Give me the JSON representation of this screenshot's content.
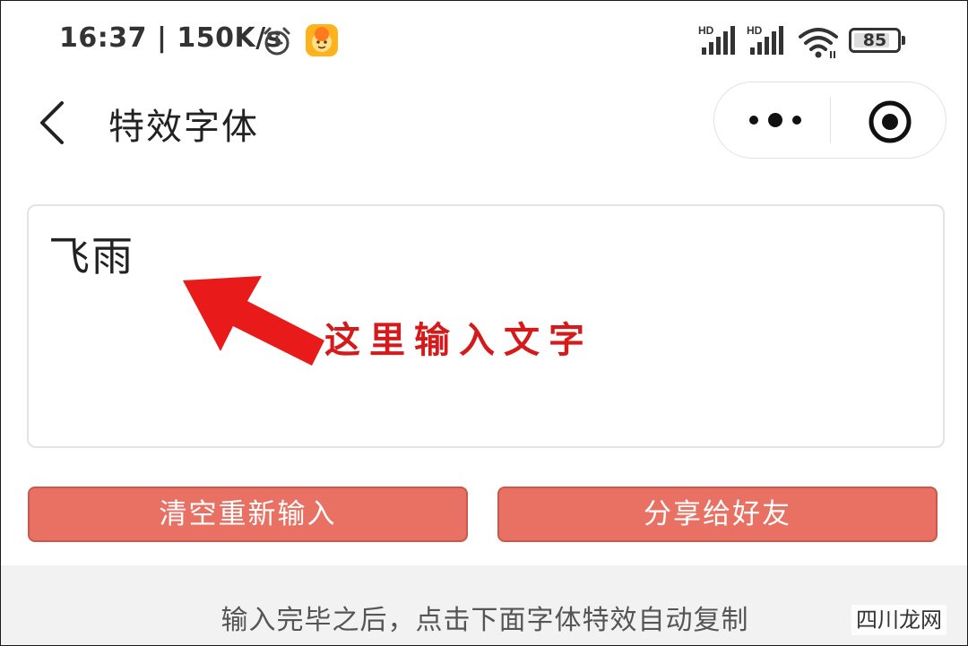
{
  "status_bar": {
    "time": "16:37 | 150K/s",
    "battery_level": "85",
    "battery_fraction": 0.85,
    "signal_1_label": "HD",
    "signal_2_label": "HD",
    "icons": [
      "alarm-icon",
      "app-notification-icon",
      "signal-icon",
      "signal-icon",
      "wifi-icon",
      "battery-icon"
    ]
  },
  "header": {
    "title": "特效字体",
    "back_icon": "back-chevron-icon",
    "more_icon": "more-dots-icon",
    "close_icon": "close-target-icon"
  },
  "input_area": {
    "value": "飞雨"
  },
  "annotation": {
    "text": "这里输入文字",
    "color": "#d41a1a"
  },
  "buttons": {
    "clear_label": "清空重新输入",
    "share_label": "分享给好友",
    "color": "#e87164"
  },
  "hint": {
    "text": "输入完毕之后，点击下面字体特效自动复制"
  },
  "watermark": {
    "text": "四川龙网"
  }
}
